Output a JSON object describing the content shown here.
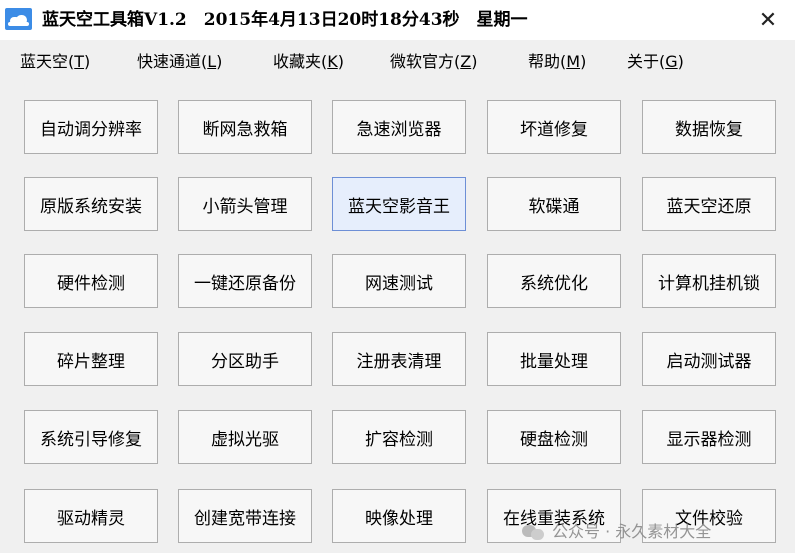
{
  "window": {
    "title": "蓝天空工具箱V1.2　2015年4月13日20时18分43秒　星期一",
    "close_glyph": "✕"
  },
  "menu": [
    {
      "label": "蓝天空(",
      "key": "T",
      "end": ")"
    },
    {
      "label": "快速通道(",
      "key": "L",
      "end": ")"
    },
    {
      "label": "收藏夹(",
      "key": "K",
      "end": ")"
    },
    {
      "label": "微软官方(",
      "key": "Z",
      "end": ")"
    },
    {
      "label": "帮助(",
      "key": "M",
      "end": ")"
    },
    {
      "label": "关于(",
      "key": "G",
      "end": ")"
    }
  ],
  "tools": [
    "自动调分辨率",
    "断网急救箱",
    "急速浏览器",
    "坏道修复",
    "数据恢复",
    "原版系统安装",
    "小箭头管理",
    "蓝天空影音王",
    "软碟通",
    "蓝天空还原",
    "硬件检测",
    "一键还原备份",
    "网速测试",
    "系统优化",
    "计算机挂机锁",
    "碎片整理",
    "分区助手",
    "注册表清理",
    "批量处理",
    "启动测试器",
    "系统引导修复",
    "虚拟光驱",
    "扩容检测",
    "硬盘检测",
    "显示器检测",
    "驱动精灵",
    "创建宽带连接",
    "映像处理",
    "在线重装系统",
    "文件校验"
  ],
  "focused_tool_index": 7,
  "watermark": "公众号 · 永久素材大全",
  "colors": {
    "focused_bg": "#e6eefc",
    "focused_border": "#6d8fd6",
    "button_border": "#adadad"
  }
}
